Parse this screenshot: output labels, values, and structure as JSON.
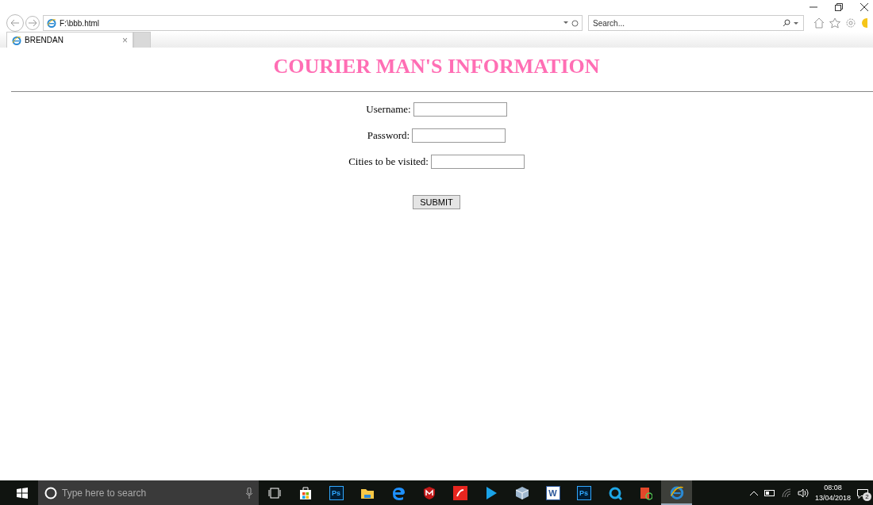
{
  "browser": {
    "address": "F:\\bbb.html",
    "search_placeholder": "Search...",
    "tabs": [
      {
        "label": "BRENDAN",
        "close": "×",
        "selected": true
      }
    ]
  },
  "page": {
    "title": "COURIER MAN'S INFORMATION",
    "fields": [
      {
        "label": "Username:"
      },
      {
        "label": "Password:"
      },
      {
        "label": "Cities to be visited:"
      }
    ],
    "submit": "SUBMIT"
  },
  "taskbar": {
    "search_placeholder": "Type here to search",
    "apps": [
      {
        "kind": "taskview"
      },
      {
        "kind": "store"
      },
      {
        "kind": "ps",
        "label": "Ps"
      },
      {
        "kind": "folder"
      },
      {
        "kind": "edge"
      },
      {
        "kind": "shield"
      },
      {
        "kind": "redapp"
      },
      {
        "kind": "play"
      },
      {
        "kind": "cube"
      },
      {
        "kind": "word",
        "label": "W"
      },
      {
        "kind": "ps",
        "label": "Ps"
      },
      {
        "kind": "q"
      },
      {
        "kind": "doc"
      },
      {
        "kind": "ie",
        "selected": true
      }
    ],
    "time": "08:08",
    "date": "13/04/2018",
    "notifications": "2"
  }
}
